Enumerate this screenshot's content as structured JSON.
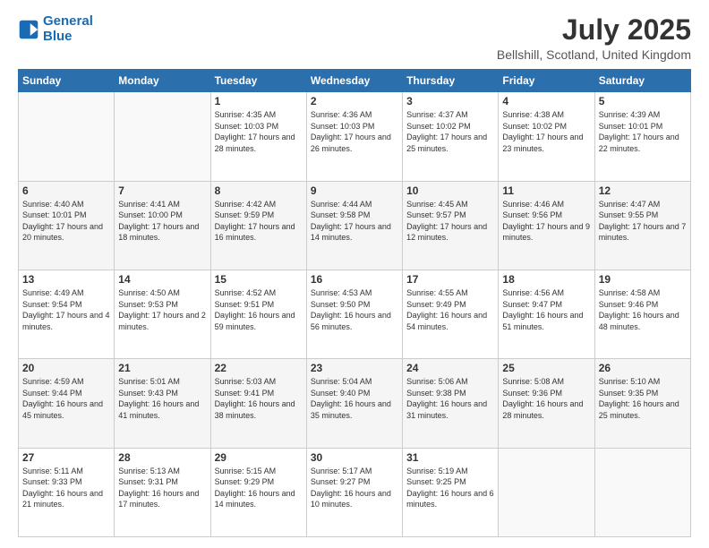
{
  "logo": {
    "line1": "General",
    "line2": "Blue"
  },
  "title": "July 2025",
  "subtitle": "Bellshill, Scotland, United Kingdom",
  "days_of_week": [
    "Sunday",
    "Monday",
    "Tuesday",
    "Wednesday",
    "Thursday",
    "Friday",
    "Saturday"
  ],
  "weeks": [
    [
      {
        "day": "",
        "info": ""
      },
      {
        "day": "",
        "info": ""
      },
      {
        "day": "1",
        "info": "Sunrise: 4:35 AM\nSunset: 10:03 PM\nDaylight: 17 hours and 28 minutes."
      },
      {
        "day": "2",
        "info": "Sunrise: 4:36 AM\nSunset: 10:03 PM\nDaylight: 17 hours and 26 minutes."
      },
      {
        "day": "3",
        "info": "Sunrise: 4:37 AM\nSunset: 10:02 PM\nDaylight: 17 hours and 25 minutes."
      },
      {
        "day": "4",
        "info": "Sunrise: 4:38 AM\nSunset: 10:02 PM\nDaylight: 17 hours and 23 minutes."
      },
      {
        "day": "5",
        "info": "Sunrise: 4:39 AM\nSunset: 10:01 PM\nDaylight: 17 hours and 22 minutes."
      }
    ],
    [
      {
        "day": "6",
        "info": "Sunrise: 4:40 AM\nSunset: 10:01 PM\nDaylight: 17 hours and 20 minutes."
      },
      {
        "day": "7",
        "info": "Sunrise: 4:41 AM\nSunset: 10:00 PM\nDaylight: 17 hours and 18 minutes."
      },
      {
        "day": "8",
        "info": "Sunrise: 4:42 AM\nSunset: 9:59 PM\nDaylight: 17 hours and 16 minutes."
      },
      {
        "day": "9",
        "info": "Sunrise: 4:44 AM\nSunset: 9:58 PM\nDaylight: 17 hours and 14 minutes."
      },
      {
        "day": "10",
        "info": "Sunrise: 4:45 AM\nSunset: 9:57 PM\nDaylight: 17 hours and 12 minutes."
      },
      {
        "day": "11",
        "info": "Sunrise: 4:46 AM\nSunset: 9:56 PM\nDaylight: 17 hours and 9 minutes."
      },
      {
        "day": "12",
        "info": "Sunrise: 4:47 AM\nSunset: 9:55 PM\nDaylight: 17 hours and 7 minutes."
      }
    ],
    [
      {
        "day": "13",
        "info": "Sunrise: 4:49 AM\nSunset: 9:54 PM\nDaylight: 17 hours and 4 minutes."
      },
      {
        "day": "14",
        "info": "Sunrise: 4:50 AM\nSunset: 9:53 PM\nDaylight: 17 hours and 2 minutes."
      },
      {
        "day": "15",
        "info": "Sunrise: 4:52 AM\nSunset: 9:51 PM\nDaylight: 16 hours and 59 minutes."
      },
      {
        "day": "16",
        "info": "Sunrise: 4:53 AM\nSunset: 9:50 PM\nDaylight: 16 hours and 56 minutes."
      },
      {
        "day": "17",
        "info": "Sunrise: 4:55 AM\nSunset: 9:49 PM\nDaylight: 16 hours and 54 minutes."
      },
      {
        "day": "18",
        "info": "Sunrise: 4:56 AM\nSunset: 9:47 PM\nDaylight: 16 hours and 51 minutes."
      },
      {
        "day": "19",
        "info": "Sunrise: 4:58 AM\nSunset: 9:46 PM\nDaylight: 16 hours and 48 minutes."
      }
    ],
    [
      {
        "day": "20",
        "info": "Sunrise: 4:59 AM\nSunset: 9:44 PM\nDaylight: 16 hours and 45 minutes."
      },
      {
        "day": "21",
        "info": "Sunrise: 5:01 AM\nSunset: 9:43 PM\nDaylight: 16 hours and 41 minutes."
      },
      {
        "day": "22",
        "info": "Sunrise: 5:03 AM\nSunset: 9:41 PM\nDaylight: 16 hours and 38 minutes."
      },
      {
        "day": "23",
        "info": "Sunrise: 5:04 AM\nSunset: 9:40 PM\nDaylight: 16 hours and 35 minutes."
      },
      {
        "day": "24",
        "info": "Sunrise: 5:06 AM\nSunset: 9:38 PM\nDaylight: 16 hours and 31 minutes."
      },
      {
        "day": "25",
        "info": "Sunrise: 5:08 AM\nSunset: 9:36 PM\nDaylight: 16 hours and 28 minutes."
      },
      {
        "day": "26",
        "info": "Sunrise: 5:10 AM\nSunset: 9:35 PM\nDaylight: 16 hours and 25 minutes."
      }
    ],
    [
      {
        "day": "27",
        "info": "Sunrise: 5:11 AM\nSunset: 9:33 PM\nDaylight: 16 hours and 21 minutes."
      },
      {
        "day": "28",
        "info": "Sunrise: 5:13 AM\nSunset: 9:31 PM\nDaylight: 16 hours and 17 minutes."
      },
      {
        "day": "29",
        "info": "Sunrise: 5:15 AM\nSunset: 9:29 PM\nDaylight: 16 hours and 14 minutes."
      },
      {
        "day": "30",
        "info": "Sunrise: 5:17 AM\nSunset: 9:27 PM\nDaylight: 16 hours and 10 minutes."
      },
      {
        "day": "31",
        "info": "Sunrise: 5:19 AM\nSunset: 9:25 PM\nDaylight: 16 hours and 6 minutes."
      },
      {
        "day": "",
        "info": ""
      },
      {
        "day": "",
        "info": ""
      }
    ]
  ]
}
